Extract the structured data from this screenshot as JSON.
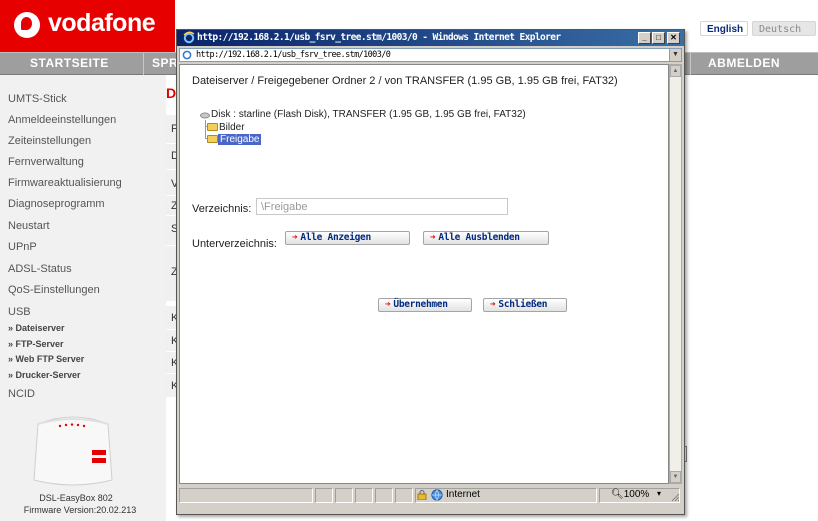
{
  "header": {
    "brand": "vodafone",
    "lang_english": "English",
    "lang_deutsch": "Deutsch"
  },
  "nav": {
    "startseite": "STARTSEITE",
    "sprache": "SPRA",
    "abmelden": "ABMELDEN"
  },
  "sidebar": {
    "items": [
      "UMTS-Stick",
      "Anmeldeeinstellungen",
      "Zeiteinstellungen",
      "Fernverwaltung",
      "Firmwareaktualisierung",
      "Diagnoseprogramm",
      "Neustart",
      "UPnP",
      "ADSL-Status",
      "QoS-Einstellungen",
      "USB"
    ],
    "sub_items": [
      "» Dateiserver",
      "» FTP-Server",
      "» Web FTP Server",
      "» Drucker-Server"
    ],
    "ncid": "NCID",
    "device_name": "DSL-EasyBox 802",
    "firmware": "Firmware Version:20.02.213"
  },
  "main": {
    "title": "Da",
    "rows": [
      "Fr",
      "D",
      "Ve",
      "Zu",
      "Si",
      "Zu",
      "K",
      "K",
      "K",
      "K"
    ]
  },
  "popup": {
    "window_title": "http://192.168.2.1/usb_fsrv_tree.stm/1003/0 - Windows Internet Explorer",
    "address": "http://192.168.2.1/usb_fsrv_tree.stm/1003/0",
    "heading": "Dateiserver / Freigegebener Ordner 2 / von  TRANSFER (1.95 GB, 1.95 GB frei, FAT32)",
    "tree_disk": "Disk : starline (Flash Disk), TRANSFER (1.95 GB, 1.95 GB frei, FAT32)",
    "tree_folders": [
      "Bilder",
      "Freigabe"
    ],
    "dir_label": "Verzeichnis:",
    "dir_value": "\\Freigabe",
    "subdir_label": "Unterverzeichnis:",
    "btn_show_all": "Alle Anzeigen",
    "btn_hide_all": "Alle Ausblenden",
    "btn_apply": "Übernehmen",
    "btn_close": "Schließen",
    "status_zone": "Internet",
    "status_zoom": "100%",
    "icon_names": [
      "ie-icon",
      "close-icon",
      "minimize-icon",
      "maximize-icon",
      "globe-icon",
      "lock-icon"
    ]
  }
}
